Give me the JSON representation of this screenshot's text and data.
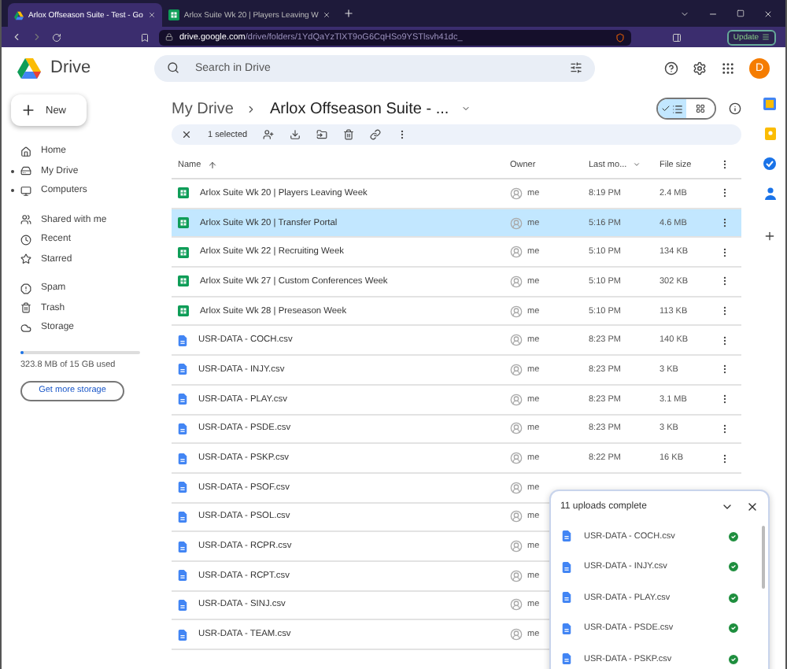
{
  "browser": {
    "tabs": [
      {
        "kind": "drive",
        "title": "Arlox Offseason Suite - Test - Go",
        "selected": true
      },
      {
        "kind": "sheet",
        "title": "Arlox Suite Wk 20 | Players Leaving W",
        "selected": false
      }
    ],
    "url": {
      "host": "drive.google.com",
      "path": "/drive/folders/1YdQaYzTlXT9oG6CqHSo9YSTlsvh41dc_"
    },
    "update": "Update"
  },
  "header": {
    "app_name": "Drive",
    "search_placeholder": "Search in Drive",
    "avatar": "D"
  },
  "sidebar": {
    "new_button": "New",
    "groups": [
      [
        {
          "label": "Home",
          "expandable": false
        },
        {
          "label": "My Drive",
          "expandable": true
        },
        {
          "label": "Computers",
          "expandable": true
        }
      ],
      [
        {
          "label": "Shared with me",
          "expandable": false
        },
        {
          "label": "Recent",
          "expandable": false
        },
        {
          "label": "Starred",
          "expandable": false
        }
      ],
      [
        {
          "label": "Spam",
          "expandable": false
        },
        {
          "label": "Trash",
          "expandable": false
        },
        {
          "label": "Storage",
          "expandable": false
        }
      ]
    ],
    "storage": {
      "level": 0.03,
      "text": "323.8 MB of 15 GB used",
      "button": "Get more storage"
    }
  },
  "breadcrumb": [
    "My Drive",
    "Arlox Offseason Suite - ..."
  ],
  "selection_bar": {
    "count": "1 selected"
  },
  "view_toggle": [
    {
      "kind": "list",
      "selected": true
    },
    {
      "kind": "grid",
      "selected": false
    }
  ],
  "columns": [
    "Name",
    "Owner",
    "Last mo...",
    "File size"
  ],
  "rows": [
    {
      "kind": "sheet",
      "name": "Arlox Suite Wk 20 | Players Leaving Week",
      "owner": "me",
      "modified": "8:19 PM",
      "size": "2.4 MB",
      "selected": false
    },
    {
      "kind": "sheet",
      "name": "Arlox Suite Wk 20 | Transfer Portal",
      "owner": "me",
      "modified": "5:16 PM",
      "size": "4.6 MB",
      "selected": true
    },
    {
      "kind": "sheet",
      "name": "Arlox Suite Wk 22 | Recruiting Week",
      "owner": "me",
      "modified": "5:10 PM",
      "size": "134 KB",
      "selected": false
    },
    {
      "kind": "sheet",
      "name": "Arlox Suite Wk 27 | Custom Conferences Week",
      "owner": "me",
      "modified": "5:10 PM",
      "size": "302 KB",
      "selected": false
    },
    {
      "kind": "sheet",
      "name": "Arlox Suite Wk 28 | Preseason Week",
      "owner": "me",
      "modified": "5:10 PM",
      "size": "113 KB",
      "selected": false
    },
    {
      "kind": "doc",
      "name": "USR-DATA - COCH.csv",
      "owner": "me",
      "modified": "8:23 PM",
      "size": "140 KB",
      "selected": false
    },
    {
      "kind": "doc",
      "name": "USR-DATA - INJY.csv",
      "owner": "me",
      "modified": "8:23 PM",
      "size": "3 KB",
      "selected": false
    },
    {
      "kind": "doc",
      "name": "USR-DATA - PLAY.csv",
      "owner": "me",
      "modified": "8:23 PM",
      "size": "3.1 MB",
      "selected": false
    },
    {
      "kind": "doc",
      "name": "USR-DATA - PSDE.csv",
      "owner": "me",
      "modified": "8:23 PM",
      "size": "3 KB",
      "selected": false
    },
    {
      "kind": "doc",
      "name": "USR-DATA - PSKP.csv",
      "owner": "me",
      "modified": "8:22 PM",
      "size": "16 KB",
      "selected": false
    },
    {
      "kind": "doc",
      "name": "USR-DATA - PSOF.csv",
      "owner": "me",
      "selected": false
    },
    {
      "kind": "doc",
      "name": "USR-DATA - PSOL.csv",
      "owner": "me",
      "selected": false
    },
    {
      "kind": "doc",
      "name": "USR-DATA - RCPR.csv",
      "owner": "me",
      "selected": false
    },
    {
      "kind": "doc",
      "name": "USR-DATA - RCPT.csv",
      "owner": "me",
      "selected": false
    },
    {
      "kind": "doc",
      "name": "USR-DATA - SINJ.csv",
      "owner": "me",
      "selected": false
    },
    {
      "kind": "doc",
      "name": "USR-DATA - TEAM.csv",
      "owner": "me",
      "selected": false
    }
  ],
  "uploads": {
    "title": "11 uploads complete",
    "items": [
      {
        "name": "USR-DATA - COCH.csv",
        "done": true
      },
      {
        "name": "USR-DATA - INJY.csv",
        "done": true
      },
      {
        "name": "USR-DATA - PLAY.csv",
        "done": true
      },
      {
        "name": "USR-DATA - PSDE.csv",
        "done": true
      },
      {
        "name": "USR-DATA - PSKP.csv",
        "done": true
      }
    ]
  }
}
